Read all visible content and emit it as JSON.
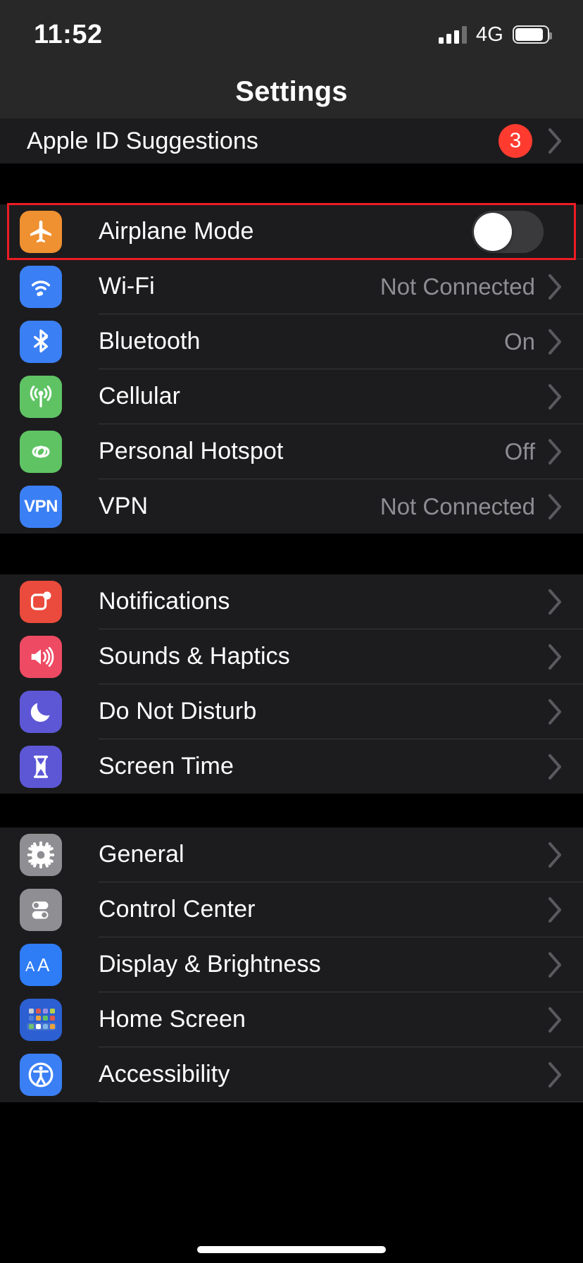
{
  "status_bar": {
    "time": "11:52",
    "network": "4G",
    "signal_bars_filled": 3,
    "signal_bars_total": 4,
    "battery_level_pct": 88
  },
  "nav": {
    "title": "Settings"
  },
  "top_row": {
    "label": "Apple ID Suggestions",
    "badge": "3",
    "chevron": "chevron-right-icon"
  },
  "groups": [
    {
      "id": "connectivity",
      "rows": [
        {
          "label": "Airplane Mode",
          "icon": "airplane-icon",
          "icon_color": "#ef9031",
          "value": "",
          "accessory": "toggle",
          "toggle_on": false,
          "highlighted": true
        },
        {
          "label": "Wi-Fi",
          "icon": "wifi-icon",
          "icon_color": "#3b7ff5",
          "value": "Not Connected",
          "accessory": "chevron"
        },
        {
          "label": "Bluetooth",
          "icon": "bluetooth-icon",
          "icon_color": "#3b7ff5",
          "value": "On",
          "accessory": "chevron"
        },
        {
          "label": "Cellular",
          "icon": "cellular-antenna-icon",
          "icon_color": "#5fc364",
          "value": "",
          "accessory": "chevron"
        },
        {
          "label": "Personal Hotspot",
          "icon": "hotspot-link-icon",
          "icon_color": "#5fc364",
          "value": "Off",
          "accessory": "chevron"
        },
        {
          "label": "VPN",
          "icon": "vpn-icon",
          "icon_color": "#3b7ff5",
          "value": "Not Connected",
          "accessory": "chevron"
        }
      ]
    },
    {
      "id": "alerts",
      "rows": [
        {
          "label": "Notifications",
          "icon": "notifications-icon",
          "icon_color": "#eb4b3c",
          "value": "",
          "accessory": "chevron"
        },
        {
          "label": "Sounds & Haptics",
          "icon": "sounds-speaker-icon",
          "icon_color": "#ef4a63",
          "value": "",
          "accessory": "chevron"
        },
        {
          "label": "Do Not Disturb",
          "icon": "moon-icon",
          "icon_color": "#5d57d6",
          "value": "",
          "accessory": "chevron"
        },
        {
          "label": "Screen Time",
          "icon": "hourglass-icon",
          "icon_color": "#5d57d6",
          "value": "",
          "accessory": "chevron"
        }
      ]
    },
    {
      "id": "system",
      "rows": [
        {
          "label": "General",
          "icon": "gear-icon",
          "icon_color": "#8e8e93",
          "value": "",
          "accessory": "chevron"
        },
        {
          "label": "Control Center",
          "icon": "control-center-toggles-icon",
          "icon_color": "#8e8e93",
          "value": "",
          "accessory": "chevron"
        },
        {
          "label": "Display & Brightness",
          "icon": "display-aa-icon",
          "icon_color": "#2e7cf6",
          "value": "",
          "accessory": "chevron"
        },
        {
          "label": "Home Screen",
          "icon": "home-screen-grid-icon",
          "icon_color": "#2c5fd1",
          "value": "",
          "accessory": "chevron"
        },
        {
          "label": "Accessibility",
          "icon": "accessibility-icon",
          "icon_color": "#3b7ff5",
          "value": "",
          "accessory": "chevron"
        }
      ]
    }
  ],
  "colors": {
    "background": "#000000",
    "row_background": "#1c1c1e",
    "separator": "#38383a",
    "primary_text": "#ffffff",
    "secondary_text": "#8e8e93",
    "badge_red": "#ff3b30",
    "highlight_red": "#ed1c24",
    "toggle_off_track": "#3a3a3c"
  }
}
